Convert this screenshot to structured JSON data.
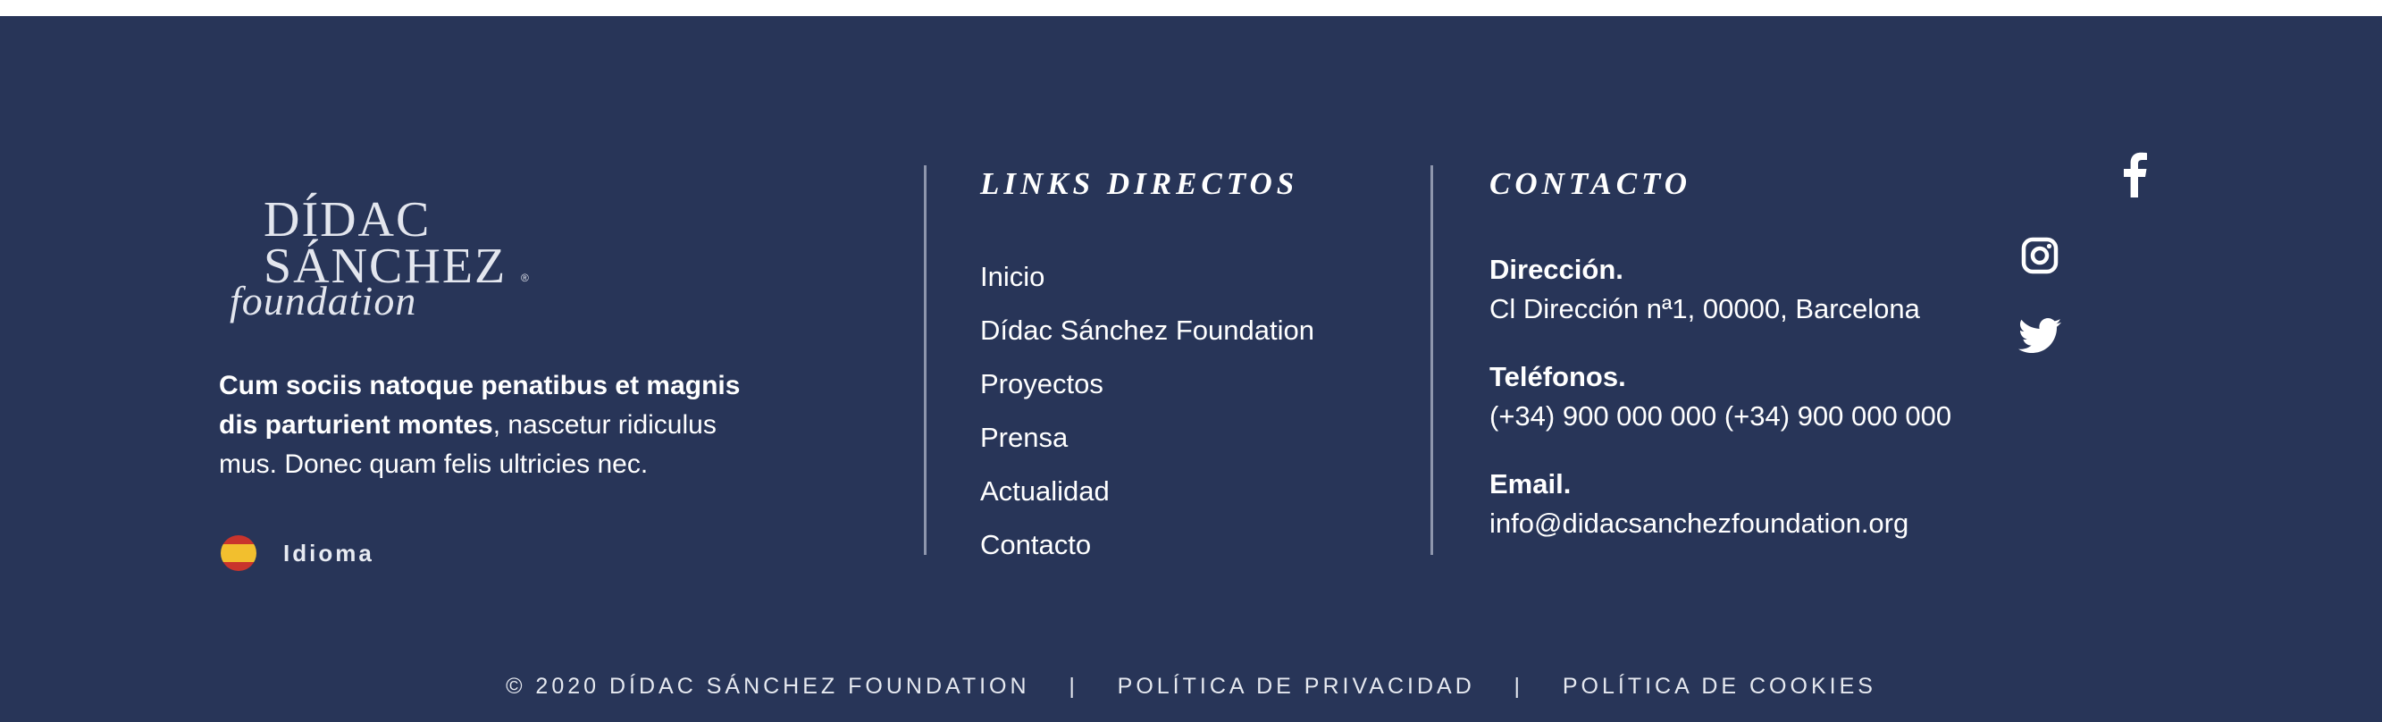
{
  "brand": {
    "logo_line1": "DÍDAC",
    "logo_line2": "SÁNCHEZ",
    "logo_line3": "foundation",
    "logo_mark": "®",
    "tagline_bold": "Cum sociis natoque penatibus et magnis dis parturient montes",
    "tagline_rest": ", nascetur ridiculus mus. Donec quam felis ultricies nec.",
    "language_label": "Idioma",
    "language_icon": "spain-flag-icon"
  },
  "links": {
    "title": "LINKS DIRECTOS",
    "items": [
      "Inicio",
      "Dídac Sánchez Foundation",
      "Proyectos",
      "Prensa",
      "Actualidad",
      "Contacto"
    ]
  },
  "contact": {
    "title": "CONTACTO",
    "address_label": "Dirección.",
    "address_value": "Cl Dirección nª1, 00000, Barcelona",
    "phone_label": "Teléfonos.",
    "phone_value": "(+34) 900 000 000 (+34) 900 000 000",
    "email_label": "Email.",
    "email_value": "info@didacsanchezfoundation.org"
  },
  "social": {
    "icons": [
      "facebook-icon",
      "instagram-icon",
      "twitter-icon"
    ]
  },
  "bottom": {
    "copyright": "© 2020 DÍDAC SÁNCHEZ FOUNDATION",
    "separator": "|",
    "privacy": "POLÍTICA DE PRIVACIDAD",
    "cookies": "POLÍTICA DE COOKIES"
  },
  "colors": {
    "background": "#283558",
    "text": "#ffffff",
    "divider": "#8e96ad"
  }
}
